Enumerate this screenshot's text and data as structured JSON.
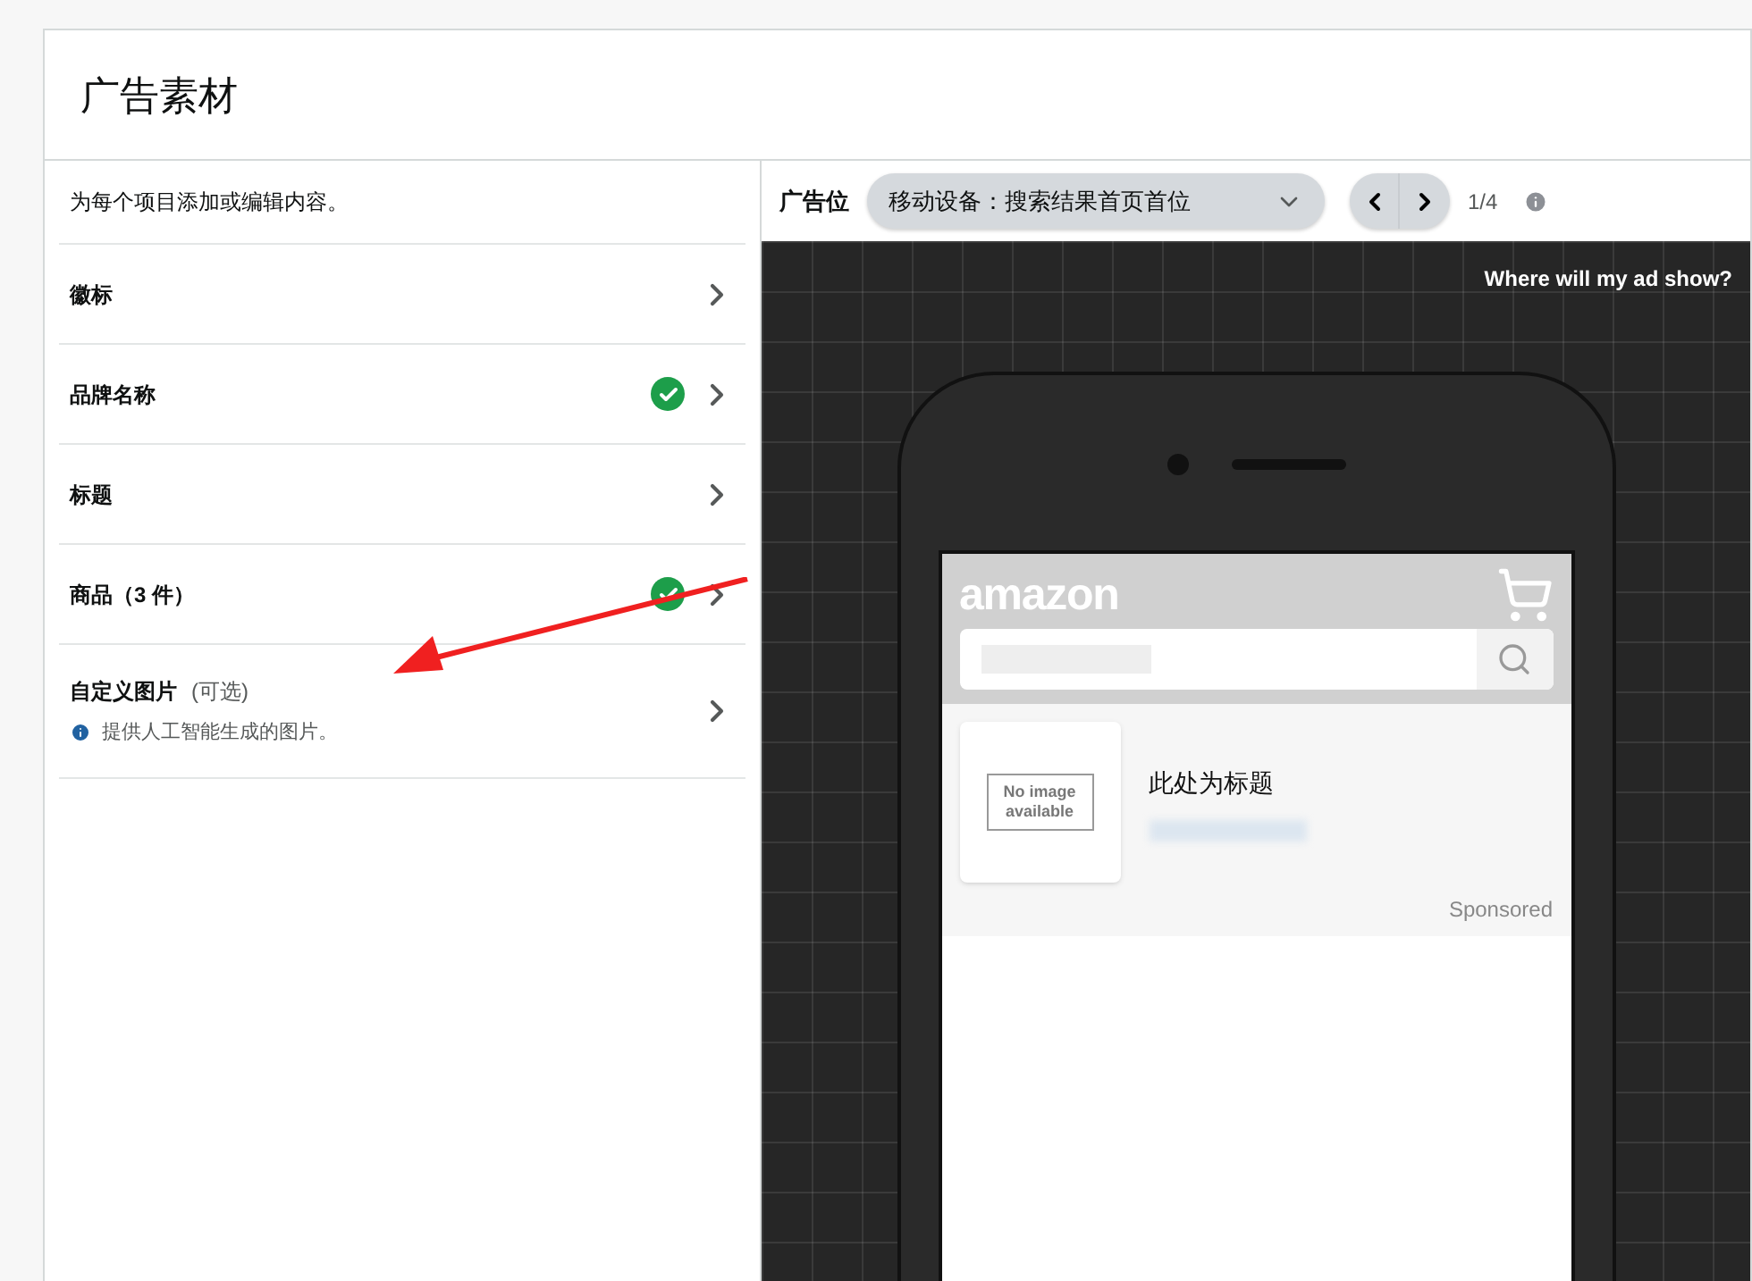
{
  "header": {
    "title": "广告素材"
  },
  "sidebar": {
    "intro": "为每个项目添加或编辑内容。",
    "items": [
      {
        "label": "徽标",
        "checked": false
      },
      {
        "label": "品牌名称",
        "checked": true
      },
      {
        "label": "标题",
        "checked": false
      },
      {
        "label": "商品（3 件）",
        "checked": true
      },
      {
        "label": "自定义图片",
        "optional": "(可选)",
        "hint": "提供人工智能生成的图片。",
        "checked": false
      }
    ]
  },
  "preview": {
    "placement_label": "广告位",
    "placement_value": "移动设备：搜索结果首页首位",
    "pager": "1/4",
    "help_link": "Where will my ad show?",
    "phone": {
      "logo": "amazon",
      "product_image_text": "No image available",
      "product_title": "此处为标题",
      "sponsored": "Sponsored"
    }
  }
}
